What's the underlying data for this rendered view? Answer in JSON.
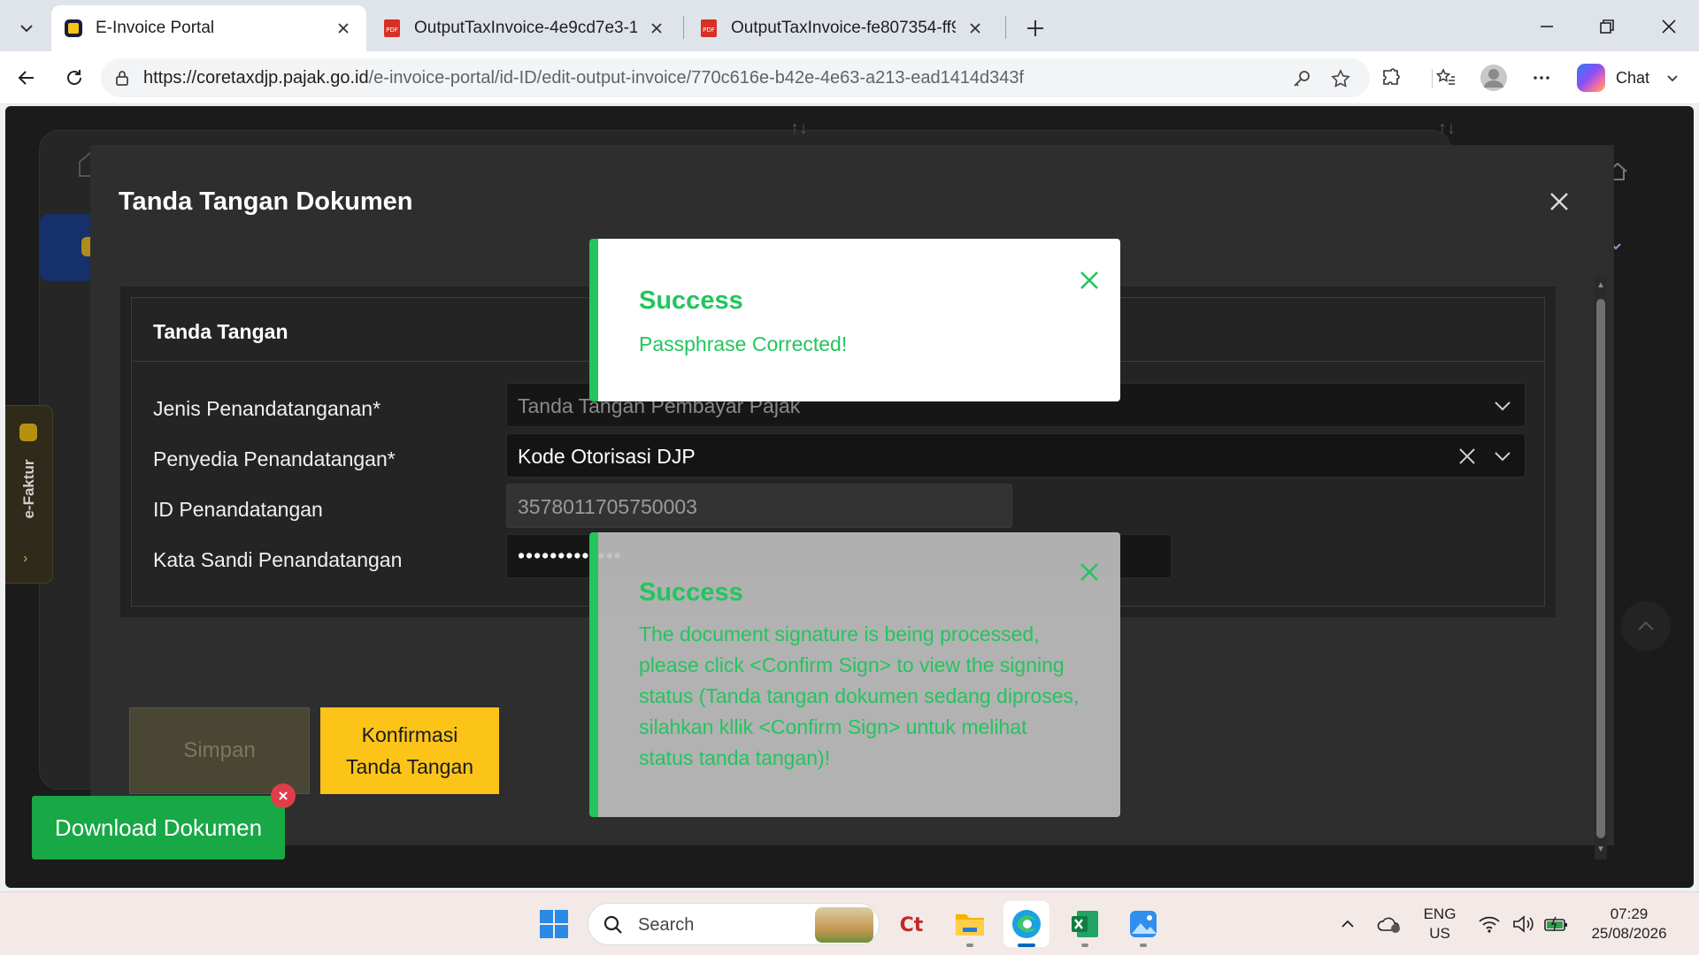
{
  "browser": {
    "tabs": [
      {
        "title": "E-Invoice Portal",
        "active": true
      },
      {
        "title": "OutputTaxInvoice-4e9cd7e3-1bf3-",
        "active": false
      },
      {
        "title": "OutputTaxInvoice-fe807354-ff9d-4",
        "active": false
      }
    ],
    "url_host": "https://coretaxdjp.pajak.go.id",
    "url_path": "/e-invoice-portal/id-ID/edit-output-invoice/770c616e-b42e-4e63-a213-ead1414d343f",
    "chat_label": "Chat"
  },
  "sidebar": {
    "efaktur_label": "e-Faktur"
  },
  "modal": {
    "title": "Tanda Tangan Dokumen",
    "section_title": "Tanda Tangan",
    "fields": {
      "jenis": {
        "label": "Jenis Penandatanganan*",
        "value": "Tanda Tangan Pembayar Pajak"
      },
      "penyedia": {
        "label": "Penyedia Penandatangan*",
        "value": "Kode Otorisasi DJP"
      },
      "id": {
        "label": "ID Penandatangan",
        "value": "3578011705750003"
      },
      "sandi": {
        "label": "Kata Sandi Penandatangan",
        "value": "•••••••••••••"
      }
    },
    "buttons": {
      "save": "Simpan",
      "confirm_line1": "Konfirmasi",
      "confirm_line2": "Tanda Tangan"
    }
  },
  "download_button": "Download Dokumen",
  "toasts": [
    {
      "title": "Success",
      "message": "Passphrase Corrected!"
    },
    {
      "title": "Success",
      "message": "The document signature is being processed, please click <Confirm Sign> to view the signing status (Tanda tangan dokumen sedang diproses, silahkan kllik <Confirm Sign> untuk melihat status tanda tangan)!"
    }
  ],
  "colors": {
    "toast_success": "#22c55e",
    "confirm_button": "#fcc419",
    "download_button": "#18a846"
  },
  "taskbar": {
    "search_placeholder": "Search",
    "lang_line1": "ENG",
    "lang_line2": "US",
    "time": "07:29",
    "date": "25/08/2026"
  }
}
